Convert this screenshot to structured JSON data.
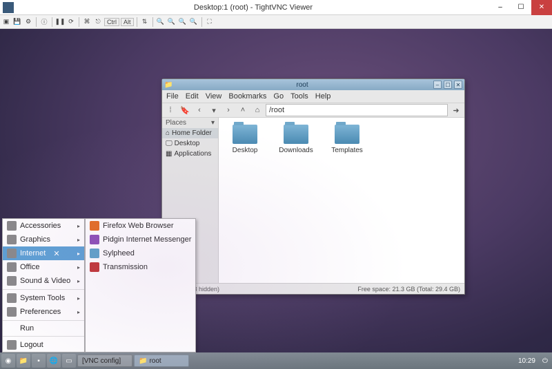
{
  "outer_window": {
    "title": "Desktop:1 (root) - TightVNC Viewer",
    "buttons": {
      "min": "–",
      "max": "☐",
      "close": "✕"
    }
  },
  "vnc_toolbar": {
    "ctrl": "Ctrl",
    "alt": "Alt"
  },
  "file_manager": {
    "title": "root",
    "menu": [
      "File",
      "Edit",
      "View",
      "Bookmarks",
      "Go",
      "Tools",
      "Help"
    ],
    "path": "/root",
    "places": {
      "header": "Places",
      "items": [
        "Home Folder",
        "Desktop",
        "Applications"
      ]
    },
    "folders": [
      "Desktop",
      "Downloads",
      "Templates"
    ],
    "status_left": "3 items (13 hidden)",
    "status_right": "Free space: 21.3 GB (Total: 29.4 GB)"
  },
  "app_menu": {
    "categories": [
      {
        "label": "Accessories",
        "has_sub": true
      },
      {
        "label": "Graphics",
        "has_sub": true
      },
      {
        "label": "Internet",
        "has_sub": true,
        "selected": true
      },
      {
        "label": "Office",
        "has_sub": true
      },
      {
        "label": "Sound & Video",
        "has_sub": true
      },
      {
        "label": "System Tools",
        "has_sub": true
      },
      {
        "label": "Preferences",
        "has_sub": true
      },
      {
        "label": "Run"
      },
      {
        "label": "Logout"
      }
    ],
    "submenu": [
      {
        "label": "Firefox Web Browser",
        "icon": "ff"
      },
      {
        "label": "Pidgin Internet Messenger",
        "icon": "pidgin"
      },
      {
        "label": "Sylpheed",
        "icon": "syl"
      },
      {
        "label": "Transmission",
        "icon": "trans"
      }
    ]
  },
  "taskbar": {
    "tasks": [
      {
        "label": "[VNC config]",
        "active": false
      },
      {
        "label": "root",
        "active": true
      }
    ],
    "clock": "10:29"
  }
}
